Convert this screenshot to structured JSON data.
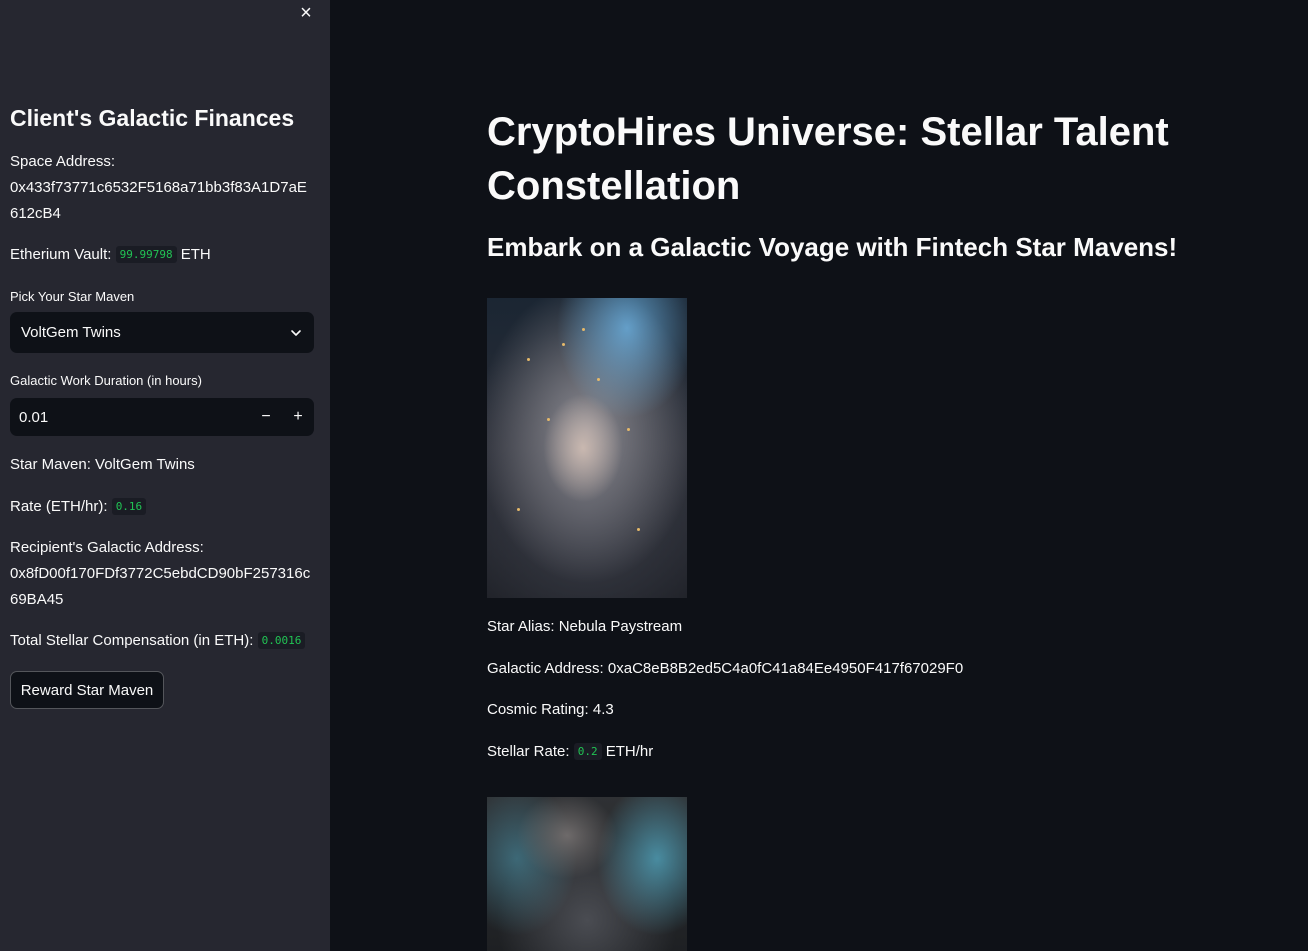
{
  "sidebar": {
    "close_label": "×",
    "title": "Client's Galactic Finances",
    "space_address_label": "Space Address:",
    "space_address": "0x433f73771c6532F5168a71bb3f83A1D7aE612cB4",
    "vault_label": "Etherium Vault:",
    "vault_value": "99.99798",
    "vault_unit": "ETH",
    "pick_label": "Pick Your Star Maven",
    "pick_selected": "VoltGem Twins",
    "duration_label": "Galactic Work Duration (in hours)",
    "duration_value": "0.01",
    "minus_label": "−",
    "plus_label": "+",
    "star_maven_text": "Star Maven: VoltGem Twins",
    "rate_label": "Rate (ETH/hr):",
    "rate_value": "0.16",
    "recipient_label": "Recipient's Galactic Address:",
    "recipient_address": "0x8fD00f170FDf3772C5ebdCD90bF257316c69BA45",
    "total_label": "Total Stellar Compensation (in ETH):",
    "total_value": "0.0016",
    "reward_button": "Reward Star Maven"
  },
  "main": {
    "title": "CryptoHires Universe: Stellar Talent Constellation",
    "subtitle": "Embark on a Galactic Voyage with Fintech Star Mavens!",
    "mavens": [
      {
        "alias_text": "Star Alias: Nebula Paystream",
        "address_text": "Galactic Address: 0xaC8eB8B2ed5C4a0fC41a84Ee4950F417f67029F0",
        "rating_text": "Cosmic Rating: 4.3",
        "rate_label": "Stellar Rate:",
        "rate_value": "0.2",
        "rate_unit": "ETH/hr"
      }
    ]
  },
  "colors": {
    "app_bg": "#0e1117",
    "sidebar_bg": "#262730",
    "code_text": "#21c354",
    "text": "#fafafa"
  },
  "icons": {
    "close": "close-icon",
    "dropdown": "chevron-down-icon"
  }
}
